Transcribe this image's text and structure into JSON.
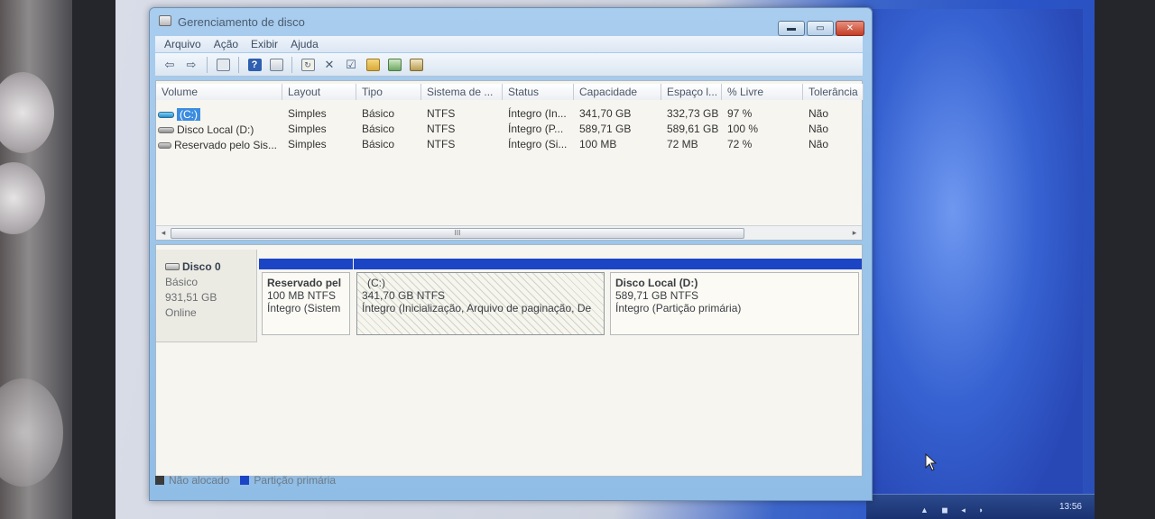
{
  "window": {
    "title": "Gerenciamento de disco",
    "buttons": {
      "minimize": "▬",
      "maximize": "▭",
      "close": "✕"
    }
  },
  "menu": [
    "Arquivo",
    "Ação",
    "Exibir",
    "Ajuda"
  ],
  "toolbar": {
    "icons": [
      "back-arrow-icon",
      "forward-arrow-icon",
      "console-tree-icon",
      "help-icon",
      "properties-icon",
      "refresh-icon",
      "delete-icon",
      "settings-icon",
      "open-folder-icon",
      "search-disk-icon",
      "format-icon"
    ]
  },
  "volume_list": {
    "columns": [
      "Volume",
      "Layout",
      "Tipo",
      "Sistema de ...",
      "Status",
      "Capacidade",
      "Espaço l...",
      "% Livre",
      "Tolerância"
    ],
    "rows": [
      {
        "volume": "(C:)",
        "layout": "Simples",
        "tipo": "Básico",
        "fs": "NTFS",
        "status": "Íntegro (In...",
        "cap": "341,70 GB",
        "free": "332,73 GB",
        "pct": "97 %",
        "tol": "Não"
      },
      {
        "volume": "Disco Local (D:)",
        "layout": "Simples",
        "tipo": "Básico",
        "fs": "NTFS",
        "status": "Íntegro (P...",
        "cap": "589,71 GB",
        "free": "589,61 GB",
        "pct": "100 %",
        "tol": "Não"
      },
      {
        "volume": "Reservado pelo Sis...",
        "layout": "Simples",
        "tipo": "Básico",
        "fs": "NTFS",
        "status": "Íntegro (Si...",
        "cap": "100 MB",
        "free": "72 MB",
        "pct": "72 %",
        "tol": "Não"
      }
    ],
    "scroll_thumb": "III"
  },
  "disk": {
    "name": "Disco 0",
    "type": "Básico",
    "size": "931,51 GB",
    "state": "Online",
    "partitions": [
      {
        "name": "Reservado pel",
        "size": "100 MB NTFS",
        "status": "Íntegro (Sistem"
      },
      {
        "name": "(C:)",
        "size": "341,70 GB NTFS",
        "status": "Íntegro (Inicialização, Arquivo de paginação, De"
      },
      {
        "name": "Disco Local  (D:)",
        "size": "589,71 GB NTFS",
        "status": "Íntegro (Partição primária)"
      }
    ]
  },
  "legend": [
    {
      "label": "Não alocado",
      "color": "#3b3b3b"
    },
    {
      "label": "Partição primária",
      "color": "#1c45c6"
    }
  ],
  "taskbar": {
    "clock": "13:56"
  }
}
